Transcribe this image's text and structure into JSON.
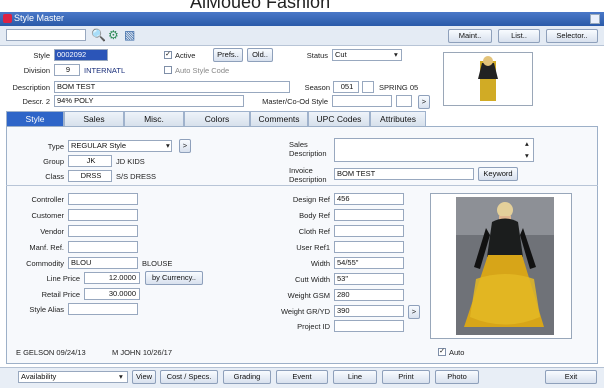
{
  "banner": {
    "text": "AlMoueo Fashion"
  },
  "window": {
    "title": "Style Master"
  },
  "toolbar": {
    "field": "",
    "maint": "Maint..",
    "list": "List..",
    "selector": "Selector.."
  },
  "header": {
    "style_label": "Style",
    "style_value": "0002092",
    "active_label": "Active",
    "active_checked": "✓",
    "prefs": "Prefs..",
    "old": "Old..",
    "status_label": "Status",
    "status_value": "Cut",
    "division_label": "Division",
    "division_code": "9",
    "division_name": "INTERNATL",
    "auto_style_label": "Auto Style Code",
    "description_label": "Description",
    "description_value": "BOM TEST",
    "season_label": "Season",
    "season_code": "051",
    "season_name": "SPRING 05",
    "descr2_label": "Descr. 2",
    "descr2_value": "94% POLY",
    "master_label": "Master/Co-Od Style",
    "master_value": "",
    "arrow": ">"
  },
  "tabs": [
    "Style",
    "Sales",
    "Misc.",
    "Colors",
    "Comments",
    "UPC Codes",
    "Attributes"
  ],
  "style_tab": {
    "type_label": "Type",
    "type_value": "REGULAR Style",
    "group_label": "Group",
    "group_code": "JK",
    "group_name": "JD KIDS",
    "class_label": "Class",
    "class_code": "DRSS",
    "class_name": "S/S DRESS",
    "sales_description_label": "Sales Description",
    "sales_description_value": "",
    "invoice_description_label": "Invoice Description",
    "invoice_description_value": "BOM TEST",
    "keyword": "Keyword",
    "left_fields": [
      {
        "label": "Controller",
        "value": ""
      },
      {
        "label": "Customer",
        "value": ""
      },
      {
        "label": "Vendor",
        "value": ""
      },
      {
        "label": "Manf. Ref.",
        "value": ""
      },
      {
        "label": "Commodity",
        "value": "BLOU",
        "extra": "BLOUSE"
      },
      {
        "label": "Line Price",
        "value": "12.0000"
      },
      {
        "label": "Retail Price",
        "value": "30.0000"
      },
      {
        "label": "Style Alias",
        "value": ""
      }
    ],
    "currency": "by Currency..",
    "right_fields": [
      {
        "label": "Design Ref",
        "value": "456"
      },
      {
        "label": "Body Ref",
        "value": ""
      },
      {
        "label": "Cloth Ref",
        "value": ""
      },
      {
        "label": "User Ref1",
        "value": ""
      },
      {
        "label": "Width",
        "value": "54/55\""
      },
      {
        "label": "Cutt Width",
        "value": "53\""
      },
      {
        "label": "Weight GSM",
        "value": "280"
      },
      {
        "label": "Weight GR/YD",
        "value": "390"
      },
      {
        "label": "Project ID",
        "value": ""
      }
    ],
    "auto_label": "Auto",
    "auto_checked": "✓"
  },
  "audit": {
    "created": "E GELSON   09/24/13",
    "modified": "M JOHN         10/26/17"
  },
  "footer": {
    "select": "Availability",
    "view": "View",
    "cost": "Cost / Specs.",
    "grading": "Grading",
    "event": "Event",
    "line": "Line",
    "print": "Print",
    "photo": "Photo",
    "exit": "Exit"
  }
}
